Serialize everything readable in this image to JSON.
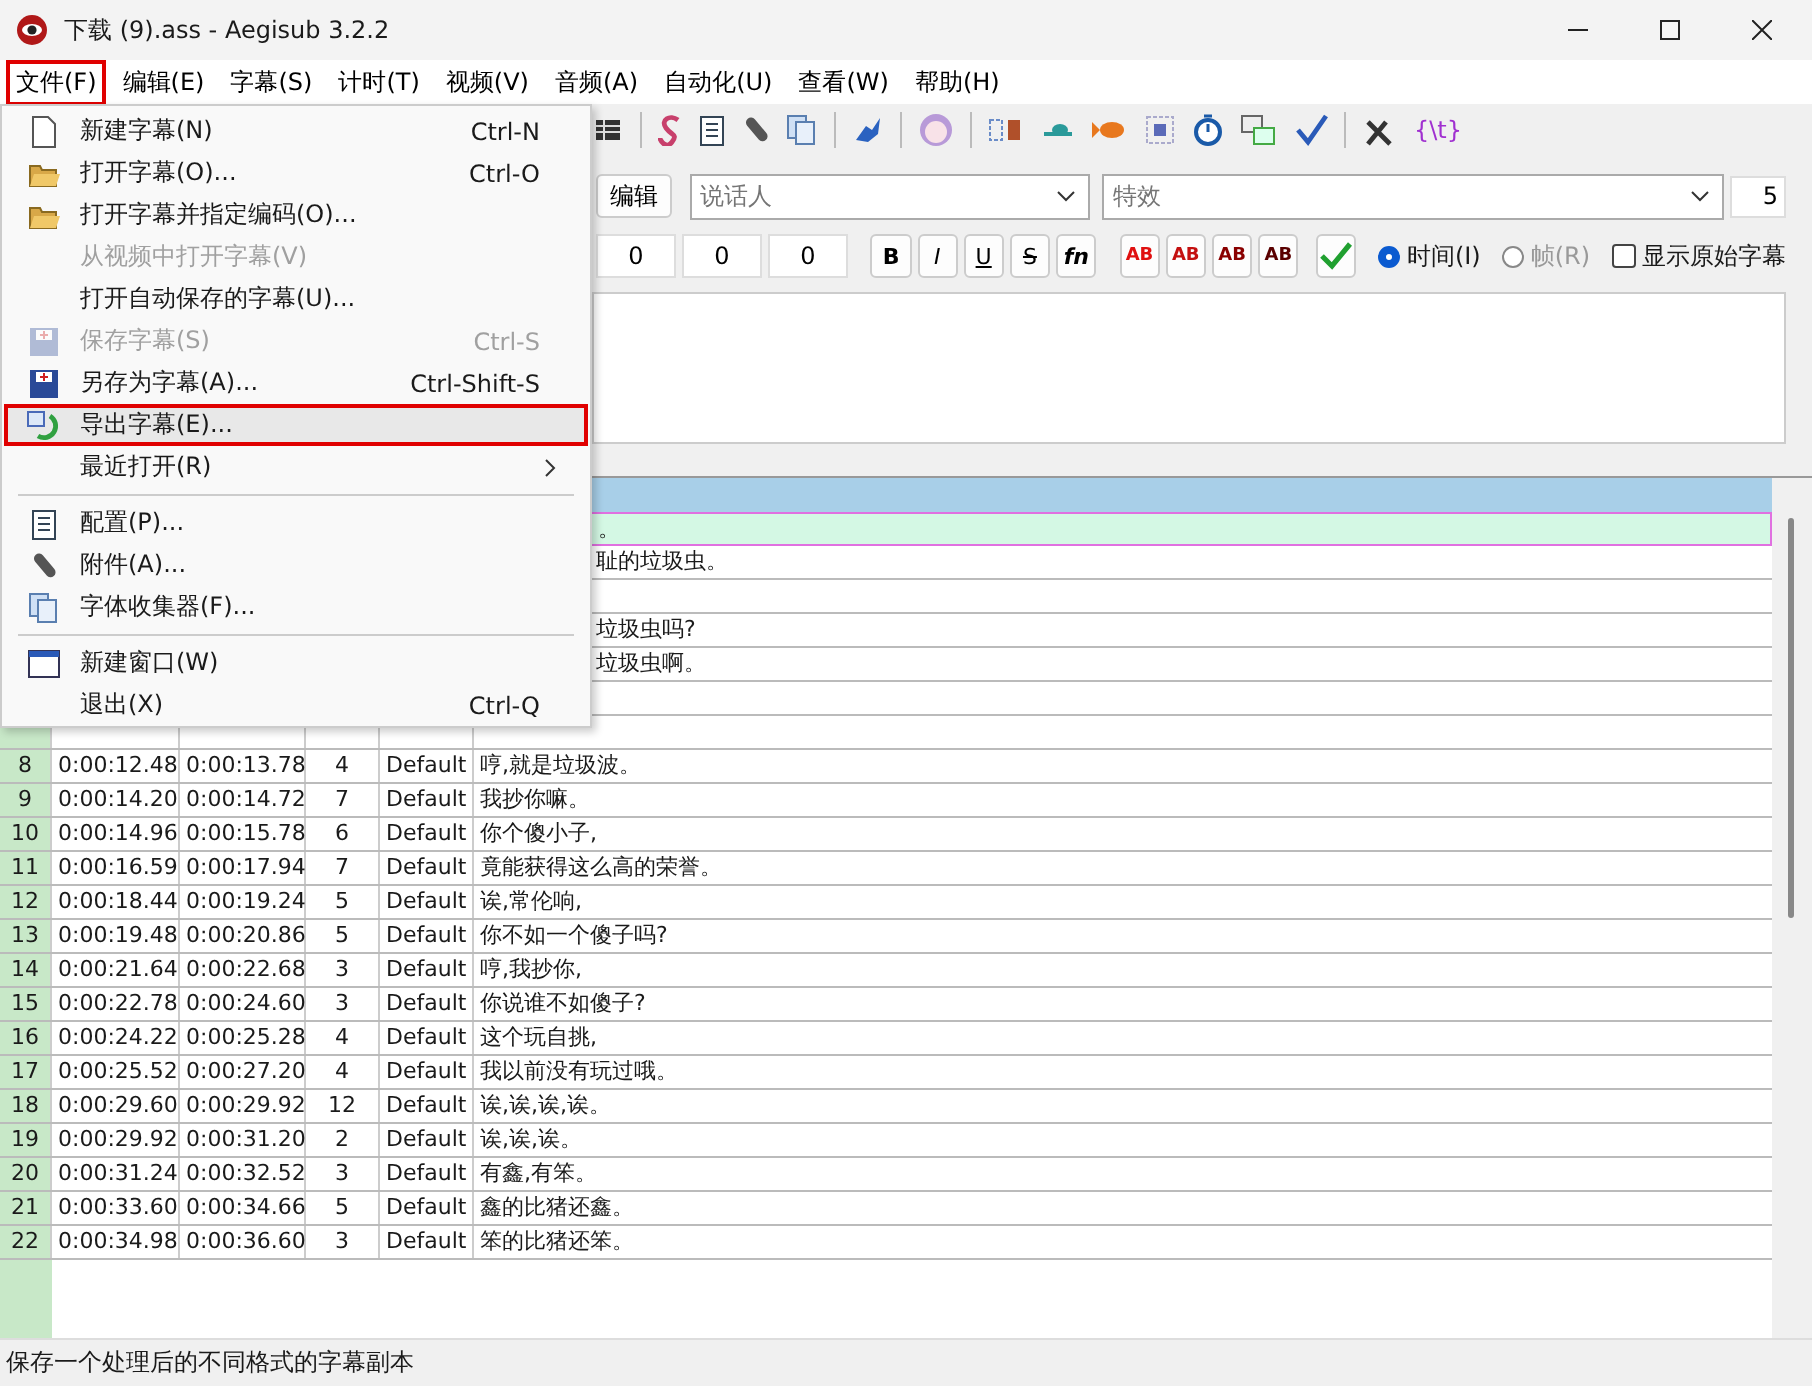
{
  "window": {
    "title": "下载 (9).ass - Aegisub 3.2.2"
  },
  "menubar": [
    {
      "label": "文件(F)",
      "selected": true
    },
    {
      "label": "编辑(E)",
      "selected": false
    },
    {
      "label": "字幕(S)",
      "selected": false
    },
    {
      "label": "计时(T)",
      "selected": false
    },
    {
      "label": "视频(V)",
      "selected": false
    },
    {
      "label": "音频(A)",
      "selected": false
    },
    {
      "label": "自动化(U)",
      "selected": false
    },
    {
      "label": "查看(W)",
      "selected": false
    },
    {
      "label": "帮助(H)",
      "selected": false
    }
  ],
  "toolbar": {
    "text_button": "{\\t}"
  },
  "editor": {
    "edit_button": "编辑",
    "actor": {
      "placeholder": "说话人"
    },
    "effect": {
      "placeholder": "特效"
    },
    "layer": "5",
    "margins": [
      "0",
      "0",
      "0"
    ],
    "format_buttons": [
      {
        "kind": "bold",
        "label": "B"
      },
      {
        "kind": "italic",
        "label": "I"
      },
      {
        "kind": "underline",
        "label": "U"
      },
      {
        "kind": "strike",
        "label": "S"
      },
      {
        "kind": "font",
        "label": "fn"
      }
    ],
    "color_buttons": [
      {
        "label": "AB",
        "color": "#e01010"
      },
      {
        "label": "AB",
        "color": "#c41010"
      },
      {
        "label": "AB",
        "color": "#8a0000"
      },
      {
        "label": "AB",
        "color": "#5a0000"
      }
    ],
    "time_mode": [
      {
        "label": "时间(I)",
        "selected": true,
        "disabled": false
      },
      {
        "label": "帧(R)",
        "selected": false,
        "disabled": true
      }
    ],
    "show_original": {
      "label": "显示原始字幕",
      "checked": false
    }
  },
  "file_menu": [
    {
      "kind": "item",
      "label": "新建字幕(N)",
      "shortcut": "Ctrl-N",
      "disabled": false,
      "highlighted": false
    },
    {
      "kind": "item",
      "label": "打开字幕(O)...",
      "shortcut": "Ctrl-O",
      "disabled": false,
      "highlighted": false
    },
    {
      "kind": "item",
      "label": "打开字幕并指定编码(O)...",
      "disabled": false,
      "highlighted": false
    },
    {
      "kind": "item",
      "label": "从视频中打开字幕(V)",
      "disabled": true,
      "highlighted": false
    },
    {
      "kind": "item",
      "label": "打开自动保存的字幕(U)...",
      "disabled": false,
      "highlighted": false
    },
    {
      "kind": "item",
      "label": "保存字幕(S)",
      "shortcut": "Ctrl-S",
      "disabled": true,
      "highlighted": false
    },
    {
      "kind": "item",
      "label": "另存为字幕(A)...",
      "shortcut": "Ctrl-Shift-S",
      "disabled": false,
      "highlighted": false
    },
    {
      "kind": "item",
      "label": "导出字幕(E)...",
      "disabled": false,
      "highlighted": true
    },
    {
      "kind": "item",
      "label": "最近打开(R)",
      "submenu": true,
      "disabled": false,
      "highlighted": false
    },
    {
      "kind": "separator"
    },
    {
      "kind": "item",
      "label": "配置(P)...",
      "disabled": false,
      "highlighted": false
    },
    {
      "kind": "item",
      "label": "附件(A)...",
      "disabled": false,
      "highlighted": false
    },
    {
      "kind": "item",
      "label": "字体收集器(F)...",
      "disabled": false,
      "highlighted": false
    },
    {
      "kind": "separator"
    },
    {
      "kind": "item",
      "label": "新建窗口(W)",
      "disabled": false,
      "highlighted": false
    },
    {
      "kind": "item",
      "label": "退出(X)",
      "shortcut": "Ctrl-Q",
      "disabled": false,
      "highlighted": false
    }
  ],
  "grid": {
    "rows": [
      {
        "text": "。",
        "selected": true
      },
      {
        "text": "耻的垃圾虫。",
        "selected": false
      },
      {
        "selected": false
      },
      {
        "text": "垃圾虫吗?",
        "selected": false
      },
      {
        "text": "垃圾虫啊。",
        "selected": false
      },
      {
        "selected": false
      },
      {
        "selected": false
      },
      {
        "num": "8",
        "start": "0:00:12.48",
        "end": "0:00:13.78",
        "cps": "4",
        "style": "Default",
        "text": "哼,就是垃圾波。",
        "selected": false
      },
      {
        "num": "9",
        "start": "0:00:14.20",
        "end": "0:00:14.72",
        "cps": "7",
        "style": "Default",
        "text": "我抄你嘛。",
        "selected": false
      },
      {
        "num": "10",
        "start": "0:00:14.96",
        "end": "0:00:15.78",
        "cps": "6",
        "style": "Default",
        "text": "你个傻小子,",
        "selected": false
      },
      {
        "num": "11",
        "start": "0:00:16.59",
        "end": "0:00:17.94",
        "cps": "7",
        "style": "Default",
        "text": "竟能获得这么高的荣誉。",
        "selected": false
      },
      {
        "num": "12",
        "start": "0:00:18.44",
        "end": "0:00:19.24",
        "cps": "5",
        "style": "Default",
        "text": "诶,常伦响,",
        "selected": false
      },
      {
        "num": "13",
        "start": "0:00:19.48",
        "end": "0:00:20.86",
        "cps": "5",
        "style": "Default",
        "text": "你不如一个傻子吗?",
        "selected": false
      },
      {
        "num": "14",
        "start": "0:00:21.64",
        "end": "0:00:22.68",
        "cps": "3",
        "style": "Default",
        "text": "哼,我抄你,",
        "selected": false
      },
      {
        "num": "15",
        "start": "0:00:22.78",
        "end": "0:00:24.60",
        "cps": "3",
        "style": "Default",
        "text": "你说谁不如傻子?",
        "selected": false
      },
      {
        "num": "16",
        "start": "0:00:24.22",
        "end": "0:00:25.28",
        "cps": "4",
        "style": "Default",
        "text": "这个玩自挑,",
        "selected": false
      },
      {
        "num": "17",
        "start": "0:00:25.52",
        "end": "0:00:27.20",
        "cps": "4",
        "style": "Default",
        "text": "我以前没有玩过哦。",
        "selected": false
      },
      {
        "num": "18",
        "start": "0:00:29.60",
        "end": "0:00:29.92",
        "cps": "12",
        "style": "Default",
        "text": "诶,诶,诶,诶。",
        "selected": false
      },
      {
        "num": "19",
        "start": "0:00:29.92",
        "end": "0:00:31.20",
        "cps": "2",
        "style": "Default",
        "text": "诶,诶,诶。",
        "selected": false
      },
      {
        "num": "20",
        "start": "0:00:31.24",
        "end": "0:00:32.52",
        "cps": "3",
        "style": "Default",
        "text": "有鑫,有笨。",
        "selected": false
      },
      {
        "num": "21",
        "start": "0:00:33.60",
        "end": "0:00:34.66",
        "cps": "5",
        "style": "Default",
        "text": "鑫的比猪还鑫。",
        "selected": false
      },
      {
        "num": "22",
        "start": "0:00:34.98",
        "end": "0:00:36.60",
        "cps": "3",
        "style": "Default",
        "text": "笨的比猪还笨。",
        "selected": false
      }
    ]
  },
  "status_bar": "保存一个处理后的不同格式的字幕副本"
}
